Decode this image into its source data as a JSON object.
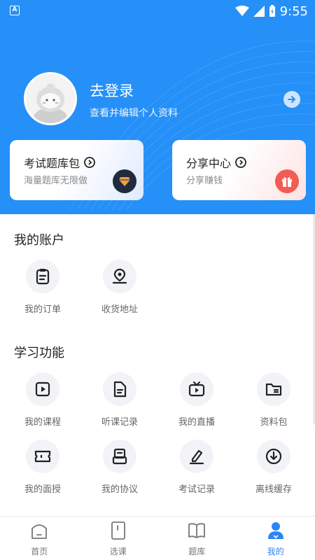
{
  "status_bar": {
    "time": "9:55",
    "left_icon_text": "A"
  },
  "profile": {
    "title": "去登录",
    "subtitle": "查看并编辑个人资料"
  },
  "cards": [
    {
      "title": "考试题库包",
      "subtitle": "海量题库无限做",
      "badge_icon": "diamond-icon"
    },
    {
      "title": "分享中心",
      "subtitle": "分享赚钱",
      "badge_icon": "gift-icon"
    }
  ],
  "account": {
    "title": "我的账户",
    "items": [
      {
        "label": "我的订单",
        "icon": "clipboard-icon"
      },
      {
        "label": "收货地址",
        "icon": "location-icon"
      }
    ]
  },
  "learning": {
    "title": "学习功能",
    "items": [
      {
        "label": "我的课程",
        "icon": "play-square-icon"
      },
      {
        "label": "听课记录",
        "icon": "document-icon"
      },
      {
        "label": "我的直播",
        "icon": "tv-icon"
      },
      {
        "label": "资料包",
        "icon": "folder-icon"
      },
      {
        "label": "我的面授",
        "icon": "ticket-icon"
      },
      {
        "label": "我的协议",
        "icon": "printer-icon"
      },
      {
        "label": "考试记录",
        "icon": "edit-icon"
      },
      {
        "label": "离线缓存",
        "icon": "download-icon"
      }
    ]
  },
  "tabbar": {
    "tabs": [
      {
        "label": "首页",
        "icon": "home-icon"
      },
      {
        "label": "选课",
        "icon": "book-page-icon"
      },
      {
        "label": "题库",
        "icon": "open-book-icon"
      },
      {
        "label": "我的",
        "icon": "user-icon"
      }
    ],
    "active_index": 3
  },
  "colors": {
    "primary": "#2590f7",
    "active_tab": "#2a86f6",
    "icon_bg": "#f1f3f7"
  }
}
